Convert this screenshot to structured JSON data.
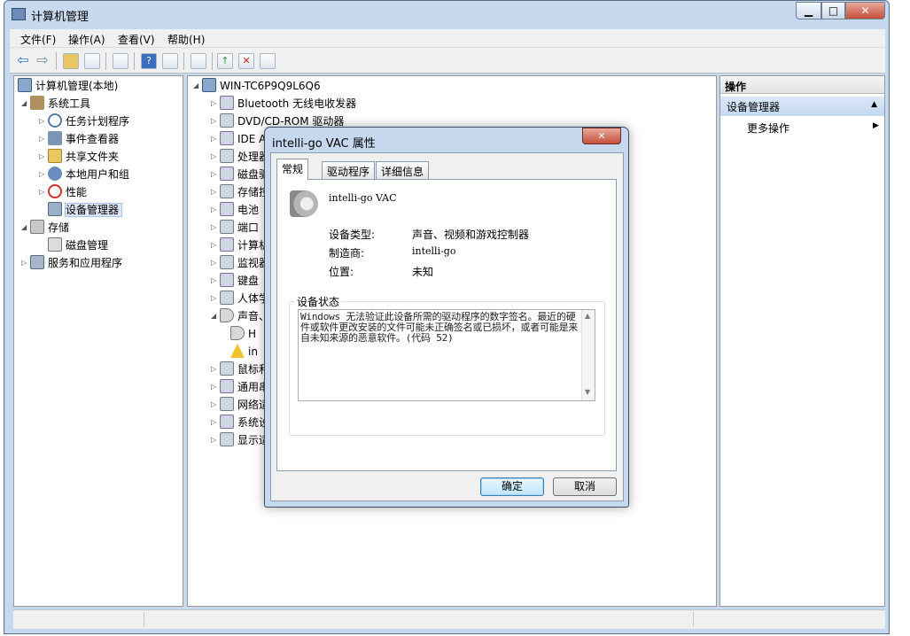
{
  "window": {
    "title": "计算机管理",
    "minimize": "▁",
    "maximize": "□",
    "close": "✕"
  },
  "menu": [
    "文件(F)",
    "操作(A)",
    "查看(V)",
    "帮助(H)"
  ],
  "toolbar": {
    "buttons": [
      "back-icon",
      "forward-icon",
      "up-folder-icon",
      "show-hide-tree-icon",
      "properties-icon",
      "help-icon",
      "show-action-pane-icon",
      "scan-hardware-icon",
      "update-driver-icon",
      "disable-device-icon",
      "uninstall-device-icon"
    ]
  },
  "left_tree": [
    {
      "label": "计算机管理(本地)",
      "level": 0,
      "expander": "",
      "icon": "computer-icon"
    },
    {
      "label": "系统工具",
      "level": 1,
      "expander": "◢",
      "icon": "tools-icon"
    },
    {
      "label": "任务计划程序",
      "level": 2,
      "expander": "▷",
      "icon": "clock-icon"
    },
    {
      "label": "事件查看器",
      "level": 2,
      "expander": "▷",
      "icon": "event-viewer-icon"
    },
    {
      "label": "共享文件夹",
      "level": 2,
      "expander": "▷",
      "icon": "shared-folder-icon"
    },
    {
      "label": "本地用户和组",
      "level": 2,
      "expander": "▷",
      "icon": "users-icon"
    },
    {
      "label": "性能",
      "level": 2,
      "expander": "▷",
      "icon": "performance-icon"
    },
    {
      "label": "设备管理器",
      "level": 2,
      "expander": "",
      "icon": "device-manager-icon"
    },
    {
      "label": "存储",
      "level": 1,
      "expander": "◢",
      "icon": "storage-icon"
    },
    {
      "label": "磁盘管理",
      "level": 2,
      "expander": "",
      "icon": "disk-icon"
    },
    {
      "label": "服务和应用程序",
      "level": 1,
      "expander": "▷",
      "icon": "services-icon"
    }
  ],
  "device_tree": {
    "root": "WIN-TC6P9Q9L6Q6",
    "items": [
      {
        "label": "Bluetooth 无线电收发器",
        "expander": "▷",
        "indent": 1,
        "icon": "bluetooth-icon"
      },
      {
        "label": "DVD/CD-ROM 驱动器",
        "expander": "▷",
        "indent": 1,
        "icon": "dvd-icon"
      },
      {
        "label": "IDE A",
        "expander": "▷",
        "indent": 1,
        "icon": "ide-icon"
      },
      {
        "label": "处理器",
        "expander": "▷",
        "indent": 1,
        "icon": "processor-icon"
      },
      {
        "label": "磁盘驱",
        "expander": "▷",
        "indent": 1,
        "icon": "disk-drive-icon"
      },
      {
        "label": "存储控",
        "expander": "▷",
        "indent": 1,
        "icon": "storage-controller-icon"
      },
      {
        "label": "电池",
        "expander": "▷",
        "indent": 1,
        "icon": "battery-icon"
      },
      {
        "label": "端口",
        "expander": "▷",
        "indent": 1,
        "icon": "port-icon"
      },
      {
        "label": "计算机",
        "expander": "▷",
        "indent": 1,
        "icon": "computer-icon"
      },
      {
        "label": "监视器",
        "expander": "▷",
        "indent": 1,
        "icon": "monitor-icon"
      },
      {
        "label": "键盘",
        "expander": "▷",
        "indent": 1,
        "icon": "keyboard-icon"
      },
      {
        "label": "人体学",
        "expander": "▷",
        "indent": 1,
        "icon": "hid-icon"
      },
      {
        "label": "声音、",
        "expander": "◢",
        "indent": 1,
        "icon": "sound-icon"
      },
      {
        "label": "H",
        "expander": "",
        "indent": 2,
        "icon": "speaker-icon"
      },
      {
        "label": "in",
        "expander": "",
        "indent": 2,
        "icon": "speaker-warning-icon"
      },
      {
        "label": "鼠标和",
        "expander": "▷",
        "indent": 1,
        "icon": "mouse-icon"
      },
      {
        "label": "通用串",
        "expander": "▷",
        "indent": 1,
        "icon": "usb-icon"
      },
      {
        "label": "网络适",
        "expander": "▷",
        "indent": 1,
        "icon": "network-icon"
      },
      {
        "label": "系统设",
        "expander": "▷",
        "indent": 1,
        "icon": "system-device-icon"
      },
      {
        "label": "显示适",
        "expander": "▷",
        "indent": 1,
        "icon": "display-adapter-icon"
      }
    ]
  },
  "actions": {
    "header": "操作",
    "group": "设备管理器",
    "group_toggle": "▲",
    "more": "更多操作",
    "more_arrow": "▶"
  },
  "dialog": {
    "title": "intelli-go VAC 属性",
    "close": "✕",
    "tabs": [
      "常规",
      "驱动程序",
      "详细信息"
    ],
    "device_name": "intelli-go VAC",
    "props": [
      {
        "label": "设备类型:",
        "value": "声音、视频和游戏控制器"
      },
      {
        "label": "制造商:",
        "value": "intelli-go"
      },
      {
        "label": "位置:",
        "value": "未知"
      }
    ],
    "status_legend": "设备状态",
    "status_text": "Windows 无法验证此设备所需的驱动程序的数字签名。最近的硬件或软件更改安装的文件可能未正确签名或已损坏，或者可能是来自未知来源的恶意软件。(代码 52)",
    "ok": "确定",
    "cancel": "取消"
  }
}
